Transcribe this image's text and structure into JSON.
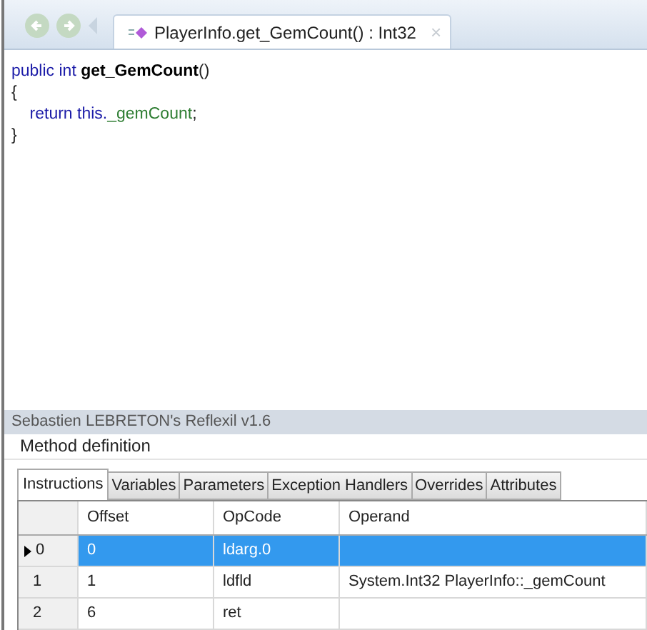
{
  "toolbar": {
    "tab": {
      "label": "PlayerInfo.get_GemCount() : Int32",
      "close": "×",
      "selected": true
    }
  },
  "code": [
    [
      {
        "text": "public int ",
        "kind": "keyword"
      },
      {
        "text": "get_GemCount",
        "kind": "name"
      },
      {
        "text": "()",
        "kind": "plain"
      }
    ],
    [
      {
        "text": "{",
        "kind": "plain"
      }
    ],
    [
      {
        "text": "    return this.",
        "kind": "keyword"
      },
      {
        "text": "_gemCount",
        "kind": "field"
      },
      {
        "text": ";",
        "kind": "plain"
      }
    ],
    [
      {
        "text": "}",
        "kind": "plain"
      }
    ]
  ],
  "panel": {
    "title": "Sebastien LEBRETON's Reflexil v1.6",
    "section": "Method definition",
    "tabs": [
      {
        "label": "Instructions",
        "selected": true
      },
      {
        "label": "Variables",
        "selected": false
      },
      {
        "label": "Parameters",
        "selected": false
      },
      {
        "label": "Exception Handlers",
        "selected": false
      },
      {
        "label": "Overrides",
        "selected": false
      },
      {
        "label": "Attributes",
        "selected": false
      }
    ],
    "table": {
      "columns": [
        "Offset",
        "OpCode",
        "Operand"
      ],
      "rows": [
        {
          "index": "0",
          "cells": [
            "0",
            "ldarg.0",
            ""
          ],
          "selected": true
        },
        {
          "index": "1",
          "cells": [
            "1",
            "ldfld",
            "System.Int32 PlayerInfo::_gemCount"
          ],
          "selected": false
        },
        {
          "index": "2",
          "cells": [
            "6",
            "ret",
            ""
          ],
          "selected": false
        }
      ]
    }
  }
}
